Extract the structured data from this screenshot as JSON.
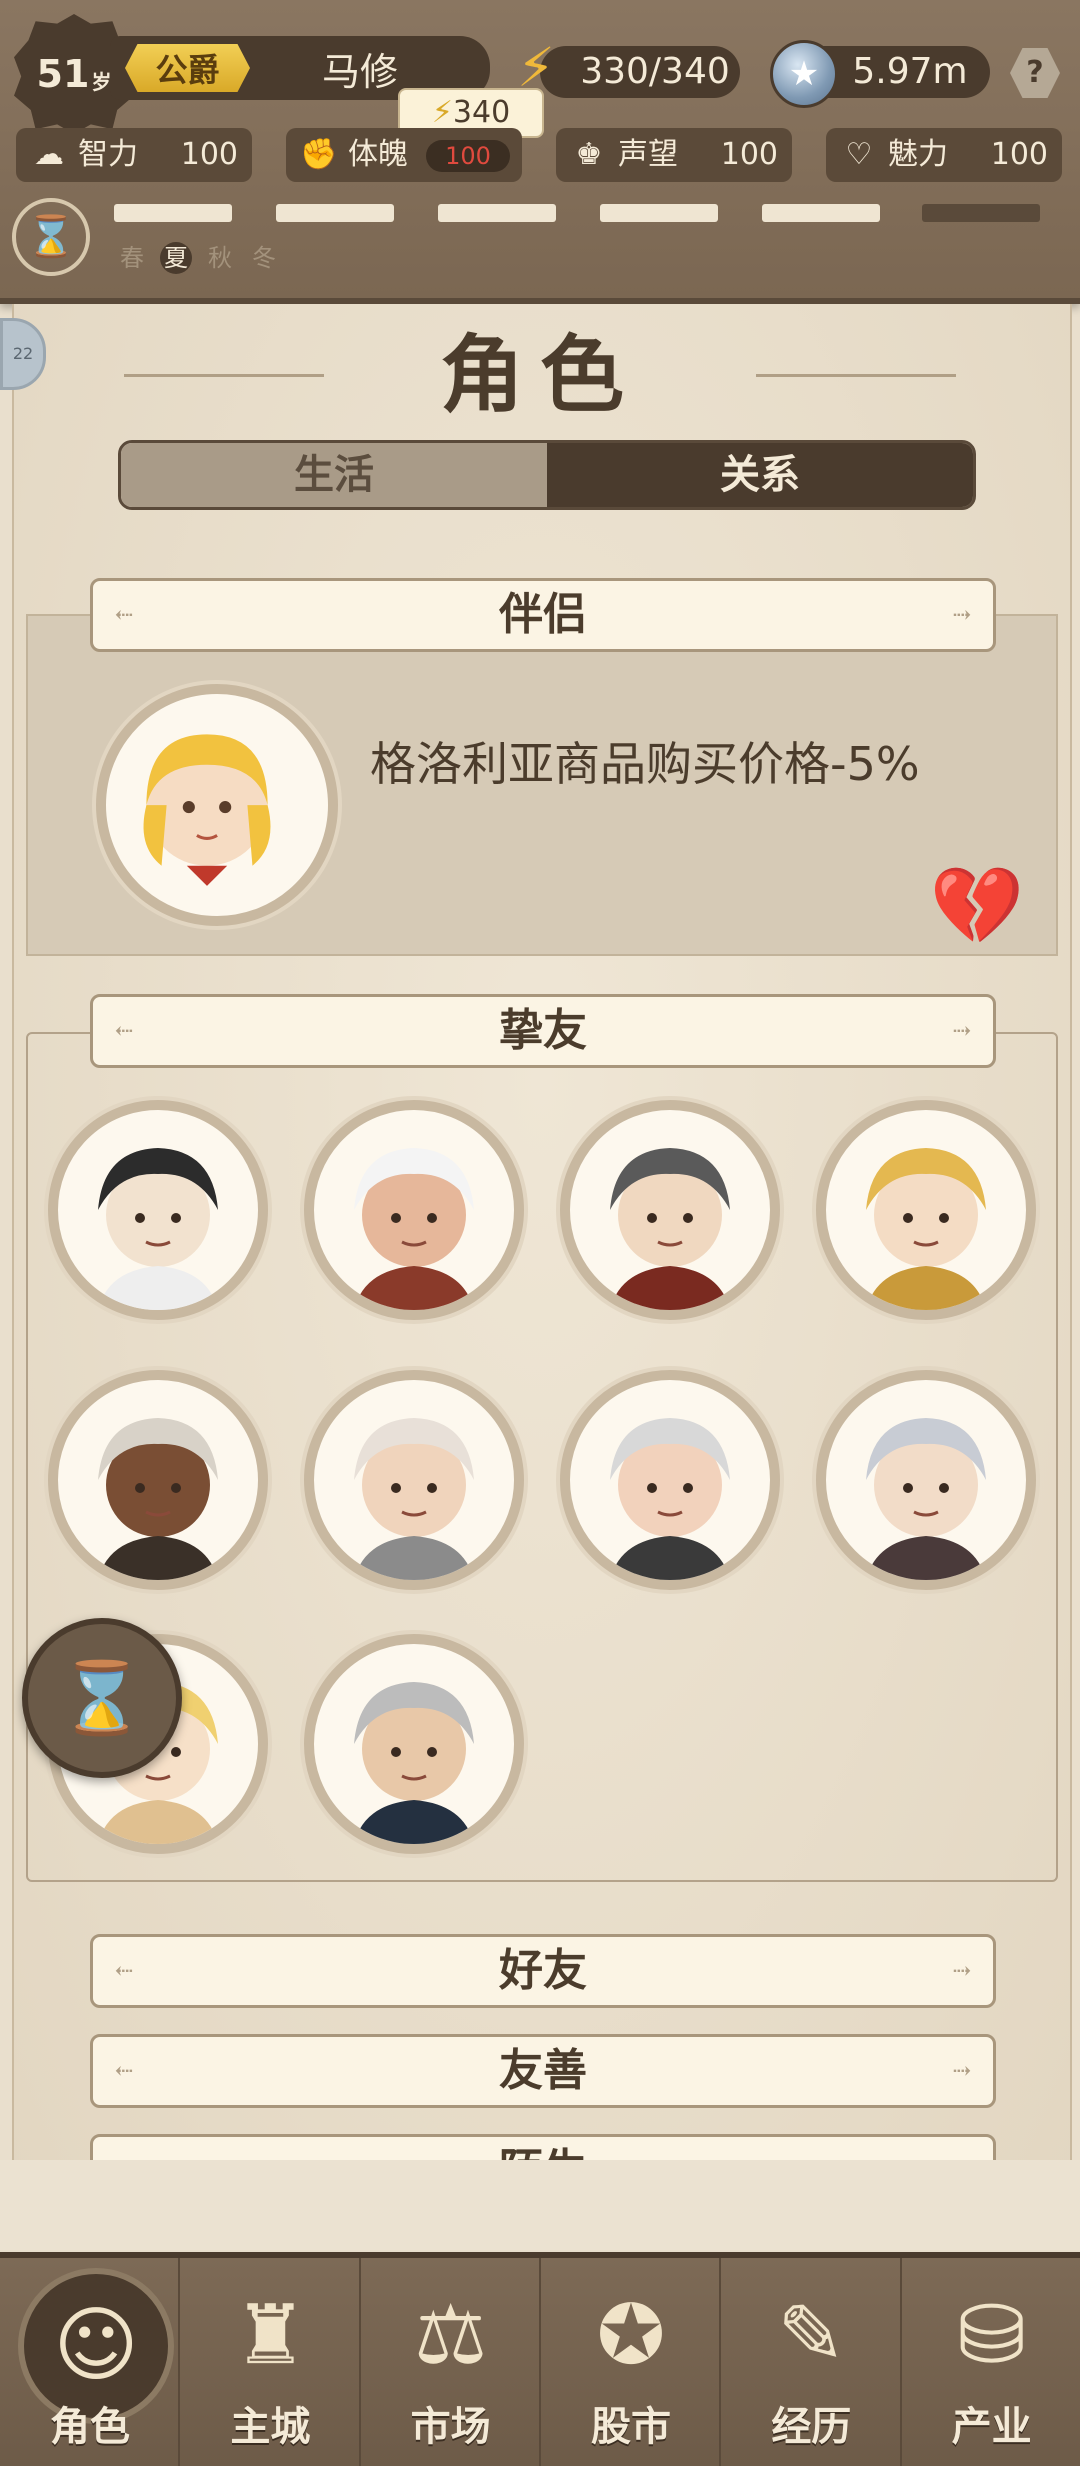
{
  "header": {
    "age": "51",
    "age_unit": "岁",
    "title": "公爵",
    "name": "马修",
    "energy": "330/340",
    "energy_tooltip": "340",
    "coins": "5.97m",
    "help": "?",
    "stats": [
      {
        "label": "智力",
        "value": "100",
        "icon": "brain-icon"
      },
      {
        "label": "体魄",
        "value": "100",
        "icon": "muscle-icon"
      },
      {
        "label": "声望",
        "value": "100",
        "icon": "crown-icon"
      },
      {
        "label": "魅力",
        "value": "100",
        "icon": "heart-pulse-icon"
      }
    ],
    "seasons": [
      "春",
      "夏",
      "秋",
      "冬"
    ],
    "active_season": "夏"
  },
  "page": {
    "title": "角色",
    "tabs": [
      {
        "label": "生活",
        "active": false
      },
      {
        "label": "关系",
        "active": true
      }
    ]
  },
  "partner": {
    "header": "伴侣",
    "bonus_text": "格洛利亚商品购买价格-5%"
  },
  "close_friends": {
    "header": "挚友",
    "portraits": [
      "old-man-top-hat",
      "hooded-woman",
      "noble-gentleman",
      "blonde-woman",
      "dark-skinned-man",
      "smiling-nun",
      "bald-elder",
      "silver-haired-lady",
      "blonde-knight",
      "eyepatch-veteran"
    ]
  },
  "sections": [
    {
      "header": "好友"
    },
    {
      "header": "友善"
    },
    {
      "header": "陌生"
    }
  ],
  "nav": [
    {
      "label": "角色",
      "icon": "character-icon",
      "active": true
    },
    {
      "label": "主城",
      "icon": "castle-icon",
      "active": false
    },
    {
      "label": "市场",
      "icon": "scales-icon",
      "active": false
    },
    {
      "label": "股市",
      "icon": "stock-icon",
      "active": false
    },
    {
      "label": "经历",
      "icon": "scroll-icon",
      "active": false
    },
    {
      "label": "产业",
      "icon": "coins-icon",
      "active": false
    }
  ],
  "colors": {
    "paper": "#e9dfcd",
    "dark_brown": "#4a3b2d",
    "gold": "#d9a928"
  }
}
